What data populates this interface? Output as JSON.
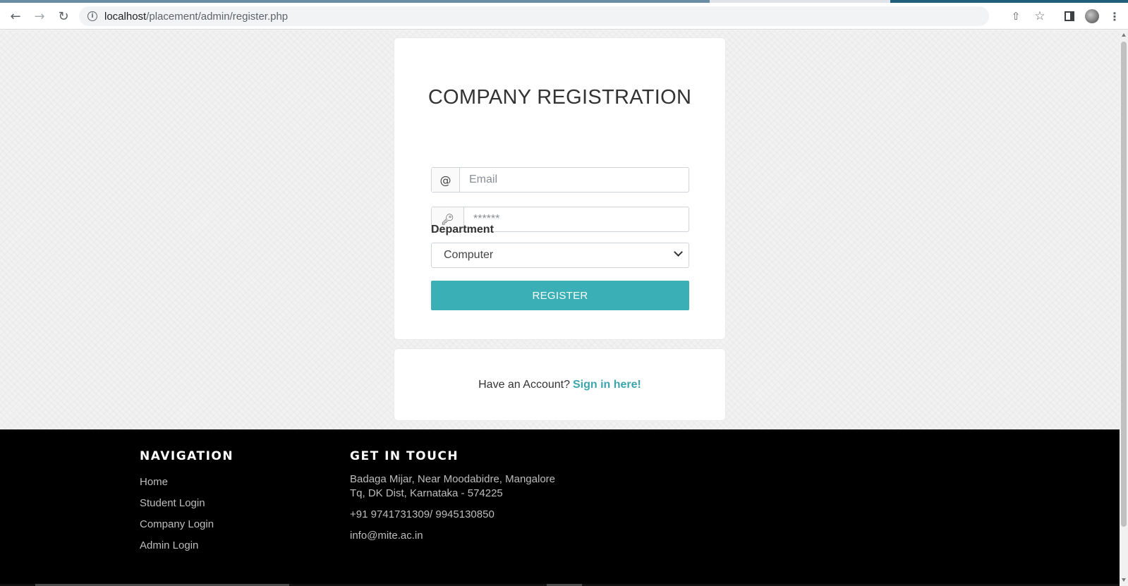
{
  "browser": {
    "url_host": "localhost",
    "url_path": "/placement/admin/register.php"
  },
  "icons": {
    "back": "back-arrow-icon",
    "forward": "forward-arrow-icon",
    "reload": "reload-icon",
    "info": "info-icon",
    "share": "share-icon",
    "bookmark": "star-icon",
    "side_panel": "side-panel-icon",
    "profile": "avatar",
    "menu": "kebab-menu-icon",
    "email_addon": "at-sign-icon",
    "password_addon": "key-icon",
    "select_arrow": "chevron-down-icon"
  },
  "form": {
    "title": "COMPANY REGISTRATION",
    "email_addon": "@",
    "email_placeholder": "Email",
    "password_placeholder": "******",
    "department_label": "Department",
    "department_selected": "Computer",
    "register_label": "REGISTER"
  },
  "signin": {
    "prompt": "Have an Account?",
    "link": "Sign in here!"
  },
  "footer": {
    "navigation": {
      "heading": "NAVIGATION",
      "links": [
        "Home",
        "Student Login",
        "Company Login",
        "Admin Login"
      ]
    },
    "contact": {
      "heading": "GET IN TOUCH",
      "address_line1": "Badaga Mijar, Near Moodabidre, Mangalore",
      "address_line2": "Tq, DK Dist, Karnataka - 574225",
      "phone": "+91 9741731309/ 9945130850",
      "email": "info@mite.ac.in"
    }
  },
  "colors": {
    "accent": "#3aafb6",
    "link": "#3aa5ad",
    "footer_bg": "#000000",
    "page_bg": "#f2f2f2"
  }
}
